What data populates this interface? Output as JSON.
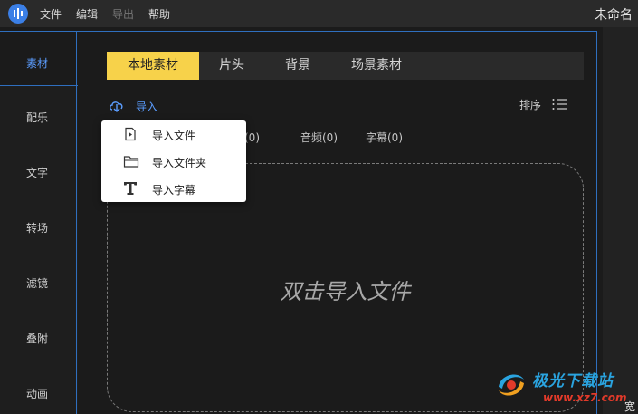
{
  "menubar": {
    "items": [
      {
        "label": "文件",
        "disabled": false
      },
      {
        "label": "编辑",
        "disabled": false
      },
      {
        "label": "导出",
        "disabled": true
      },
      {
        "label": "帮助",
        "disabled": false
      }
    ],
    "doc_title": "未命名"
  },
  "sidebar": {
    "items": [
      {
        "label": "素材",
        "active": true
      },
      {
        "label": "配乐"
      },
      {
        "label": "文字"
      },
      {
        "label": "转场"
      },
      {
        "label": "滤镜"
      },
      {
        "label": "叠附"
      },
      {
        "label": "动画"
      }
    ]
  },
  "tabs": [
    {
      "label": "本地素材",
      "active": true
    },
    {
      "label": "片头"
    },
    {
      "label": "背景"
    },
    {
      "label": "场景素材"
    }
  ],
  "toolbar": {
    "import_label": "导入",
    "sort_label": "排序"
  },
  "filters": [
    {
      "label": "片(0)"
    },
    {
      "label": "音频(0)"
    },
    {
      "label": "字幕(0)"
    }
  ],
  "dropzone": {
    "text": "双击导入文件"
  },
  "popup_menu": {
    "items": [
      {
        "label": "导入文件",
        "icon": "file-play-icon"
      },
      {
        "label": "导入文件夹",
        "icon": "folder-icon"
      },
      {
        "label": "导入字幕",
        "icon": "text-t-icon"
      }
    ]
  },
  "corner_text": "宽",
  "watermark": {
    "text": "极光下载站",
    "url": "www.xz7.com"
  },
  "colors": {
    "accent": "#5b9dff",
    "tab_active": "#f7d24a",
    "border": "#2f6fbf"
  }
}
